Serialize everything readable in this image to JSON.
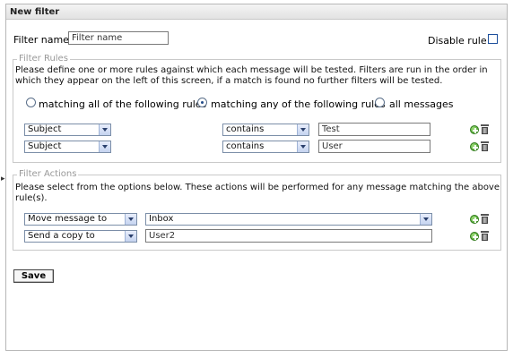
{
  "header": {
    "title": "New filter"
  },
  "filter_name": {
    "label": "Filter name",
    "value": "Filter name"
  },
  "disable_rule": {
    "label": "Disable rule",
    "checked": false
  },
  "filter_rules": {
    "legend": "Filter Rules",
    "description": "Please define one or more rules against which each message will be tested. Filters are run in the order in which they appear on the left of this screen, if a match is found no further filters will be tested.",
    "match_options": [
      {
        "label": "matching all of the following rules",
        "selected": false
      },
      {
        "label": "matching any of the following rules",
        "selected": true
      },
      {
        "label": "all messages",
        "selected": false
      }
    ],
    "rules": [
      {
        "field": "Subject",
        "operator": "contains",
        "value": "Test"
      },
      {
        "field": "Subject",
        "operator": "contains",
        "value": "User"
      }
    ]
  },
  "filter_actions": {
    "legend": "Filter Actions",
    "description": "Please select from the options below. These actions will be performed for any message matching the above rule(s).",
    "actions": [
      {
        "action": "Move message to",
        "target": "Inbox"
      },
      {
        "action": "Send a copy to",
        "target": "User2"
      }
    ]
  },
  "save_label": "Save"
}
